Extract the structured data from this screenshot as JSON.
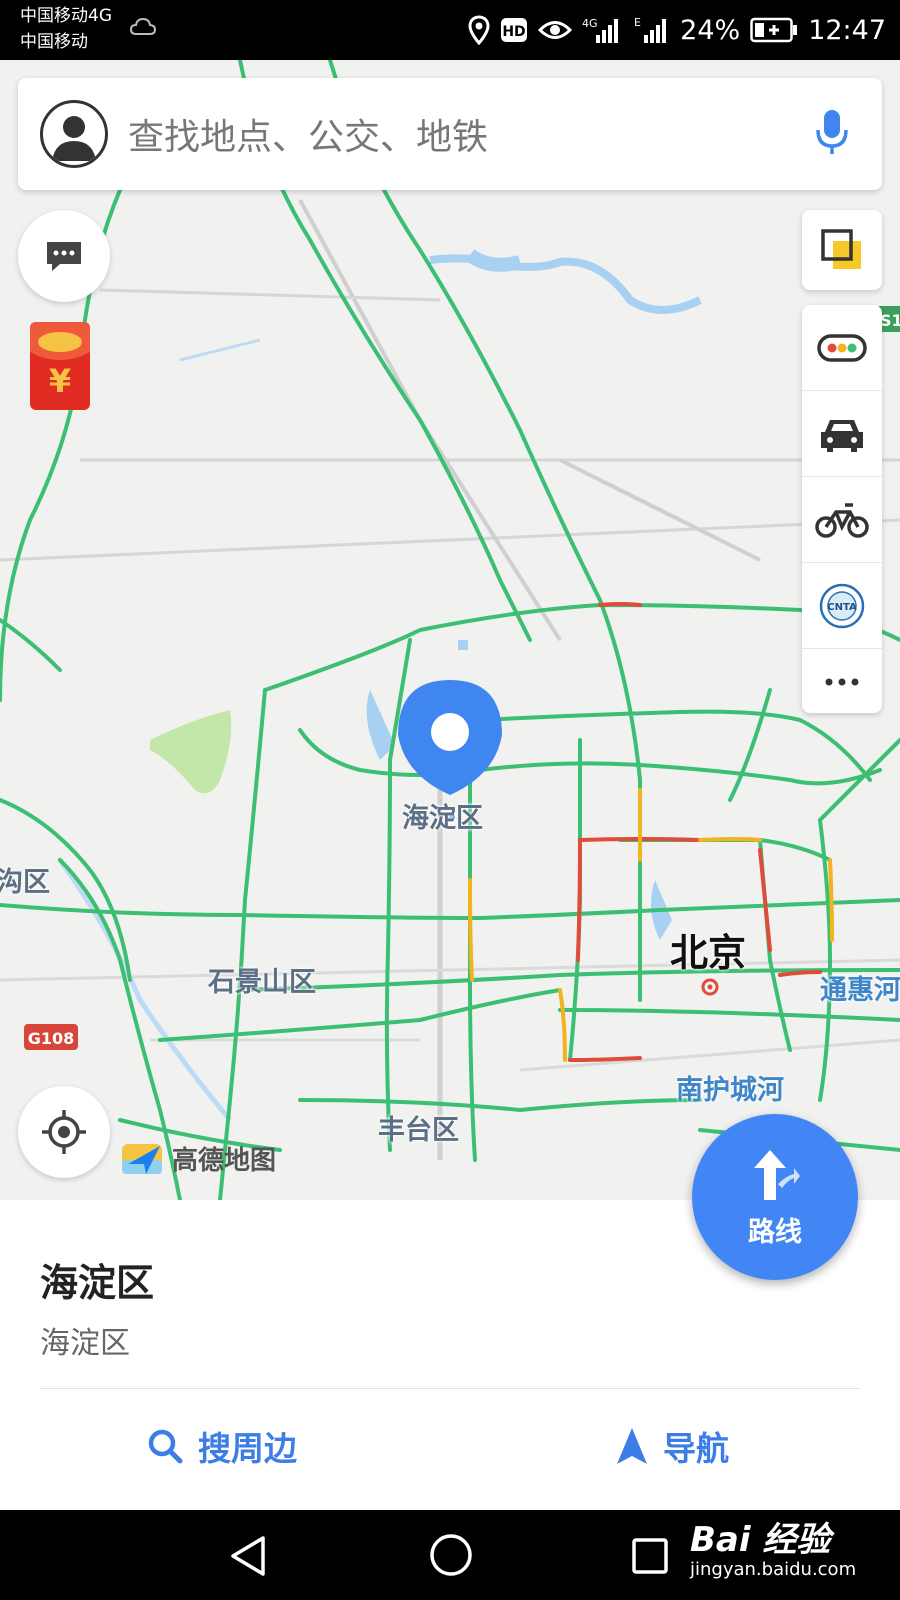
{
  "status_bar": {
    "carrier_1": "中国移动4G",
    "carrier_2": "中国移动",
    "battery": "24%",
    "time": "12:47",
    "icons": [
      "cloud-weather-icon",
      "location-icon",
      "hd-icon",
      "eye-icon",
      "signal-4g-icon",
      "signal-e-icon",
      "battery-icon"
    ]
  },
  "search": {
    "placeholder": "查找地点、公交、地铁",
    "icons": [
      "avatar-icon",
      "microphone-icon"
    ]
  },
  "map": {
    "labels": {
      "haidian": "海淀区",
      "beijing": "北京",
      "shijingshan": "石景山区",
      "fengtai": "丰台区",
      "tonghuihe": "通惠河",
      "nanhuchenghe": "南护城河",
      "partial_left": "沟区",
      "g108": "G108",
      "s1": "S1"
    },
    "logo_text": "高德地图",
    "colors": {
      "road": "#3cbf73",
      "congestion_red": "#e14b3b",
      "congestion_yellow": "#f2b31e",
      "pin": "#3f86f0"
    }
  },
  "side_buttons": {
    "left": [
      "message-icon",
      "red-envelope-icon",
      "locate-icon"
    ],
    "right": [
      "layers-icon",
      "traffic-light-icon",
      "taxi-icon",
      "bicycle-icon",
      "cnta-icon",
      "more-icon"
    ]
  },
  "route_button": {
    "label": "路线"
  },
  "sheet": {
    "title": "海淀区",
    "subtitle": "海淀区",
    "actions": {
      "nearby": "搜周边",
      "navigate": "导航"
    }
  },
  "watermark": {
    "brand": "Bai 经验",
    "url": "jingyan.baidu.com"
  }
}
